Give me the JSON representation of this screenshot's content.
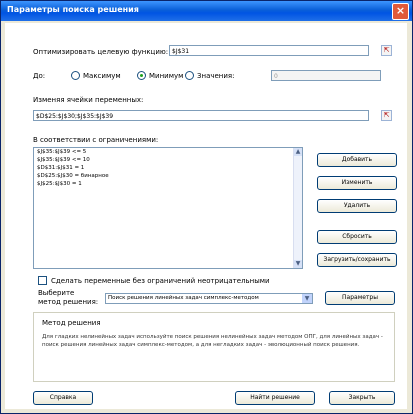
{
  "window": {
    "title": "Параметры поиска решения",
    "close_glyph": "×"
  },
  "objective": {
    "label": "Оптимизировать целевую функцию:",
    "value": "$J$31"
  },
  "to": {
    "label": "До:",
    "options": [
      {
        "label": "Максимум",
        "selected": false
      },
      {
        "label": "Минимум",
        "selected": true
      },
      {
        "label": "Значения:",
        "selected": false
      }
    ],
    "value": "0"
  },
  "variables": {
    "label": "Изменяя ячейки переменных:",
    "value": "$D$25:$J$30;$J$35:$J$39"
  },
  "constraints": {
    "label": "В соответствии с ограничениями:",
    "items": [
      "$J$35:$J$39 <= 5",
      "$J$35:$J$39 <= 10",
      "$D$31:$J$31 = 1",
      "$D$25:$J$30 = бинарное",
      "$J$25:$J$30 = 1"
    ]
  },
  "buttons": {
    "add": "Добавить",
    "change": "Изменить",
    "delete": "Удалить",
    "reset": "Сбросить",
    "load_save": "Загрузить/сохранить",
    "parameters": "Параметры",
    "help": "Справка",
    "solve": "Найти решение",
    "close": "Закрыть"
  },
  "nonneg": {
    "label": "Сделать переменные без ограничений неотрицательными",
    "checked": false
  },
  "method": {
    "label_line1": "Выберите",
    "label_line2": "метод решения:",
    "value": "Поиск решения линейных задач симплекс-методом"
  },
  "method_box": {
    "title": "Метод решения",
    "description": "Для гладких нелинейных задач используйте поиск решения нелинейных задач методом ОПГ, для линейных задач - поиск решения линейных задач симплекс-методом, а для негладких задач - эволюционный поиск решения."
  }
}
